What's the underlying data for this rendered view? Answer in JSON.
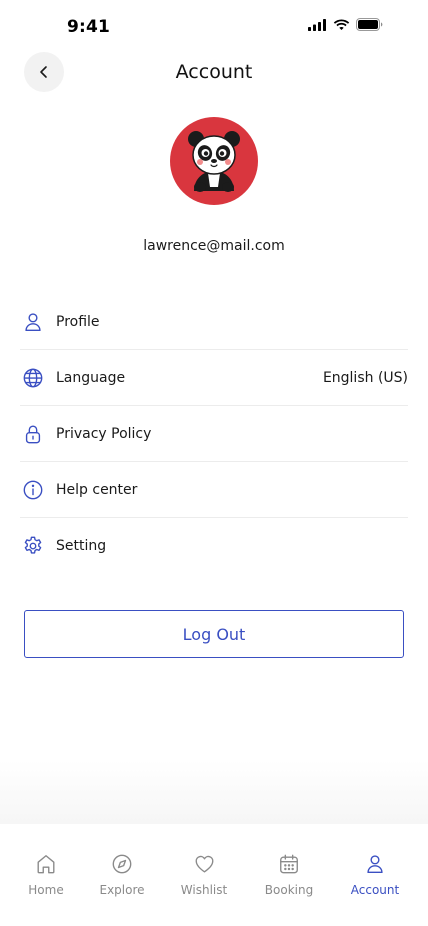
{
  "status_bar": {
    "time": "9:41"
  },
  "header": {
    "title": "Account"
  },
  "profile": {
    "email": "lawrence@mail.com"
  },
  "menu": [
    {
      "label": "Profile",
      "icon": "user-icon",
      "value": ""
    },
    {
      "label": "Language",
      "icon": "globe-icon",
      "value": "English (US)"
    },
    {
      "label": "Privacy Policy",
      "icon": "lock-icon",
      "value": ""
    },
    {
      "label": "Help center",
      "icon": "info-icon",
      "value": ""
    },
    {
      "label": "Setting",
      "icon": "gear-icon",
      "value": ""
    }
  ],
  "logout": {
    "label": "Log Out"
  },
  "tabs": [
    {
      "label": "Home",
      "icon": "home-icon",
      "active": false
    },
    {
      "label": "Explore",
      "icon": "compass-icon",
      "active": false
    },
    {
      "label": "Wishlist",
      "icon": "heart-icon",
      "active": false
    },
    {
      "label": "Booking",
      "icon": "calendar-icon",
      "active": false
    },
    {
      "label": "Account",
      "icon": "user-icon",
      "active": true
    }
  ],
  "colors": {
    "accent": "#3a4fc2",
    "avatar_bg": "#d9363e",
    "inactive": "#8a8a8a"
  }
}
